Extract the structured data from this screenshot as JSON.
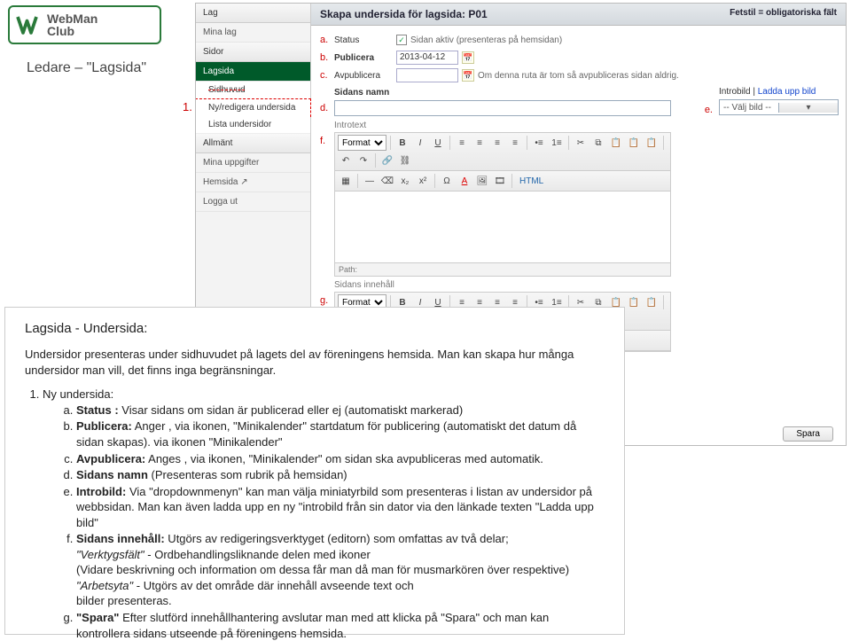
{
  "logo": {
    "l1": "WebMan",
    "l2": "Club"
  },
  "slide_title": "Ledare – \"Lagsida\"",
  "marker1": "1.",
  "side": {
    "grp_lag": "Lag",
    "mina_lag": "Mina lag",
    "grp_sidor": "Sidor",
    "lagsida": "Lagsida",
    "sidhuvud": "Sidhuvud",
    "ny_undersida": "Ny/redigera undersida",
    "lista_undersidor": "Lista undersidor",
    "grp_allmant": "Allmänt",
    "mina_uppgifter": "Mina uppgifter",
    "hemsida": "Hemsida ↗",
    "logga_ut": "Logga ut"
  },
  "header": {
    "title": "Skapa undersida för lagsida: P01",
    "required": "Fetstil = obligatoriska fält"
  },
  "rows": {
    "a": {
      "ann": "a.",
      "lab": "Status",
      "desc": "Sidan aktiv (presenteras på hemsidan)",
      "chk": "✓"
    },
    "b": {
      "ann": "b.",
      "lab": "Publicera",
      "date": "2013-04-12"
    },
    "c": {
      "ann": "c.",
      "lab": "Avpublicera",
      "desc": "Om denna ruta är tom så avpubliceras sidan aldrig."
    },
    "d": {
      "ann": "d.",
      "lab": "Sidans namn"
    },
    "f": {
      "ann": "f."
    },
    "g": {
      "ann": "g."
    },
    "e": {
      "ann": "e."
    }
  },
  "sec": {
    "introtext": "Introtext",
    "sidans_innehall": "Sidans innehåll",
    "path": "Path:",
    "format": "Format"
  },
  "intro": {
    "toplnk_pre": "Introbild | ",
    "toplnk_link": "Ladda upp bild",
    "sel": "-- Välj bild --",
    "dd": "▾"
  },
  "tb": {
    "html": "HTML"
  },
  "save": "Spara",
  "help": {
    "title": "Lagsida - Undersida:",
    "intro": "Undersidor presenteras under sidhuvudet på lagets del av föreningens hemsida. Man kan skapa hur många undersidor man vill, det finns inga begränsningar.",
    "li1": "Ny undersida:",
    "a": "Status : Visar sidans om sidan är publicerad eller ej (automatiskt markerad)",
    "b": "Publicera: Anger , via ikonen, \"Minikalender\" startdatum för publicering (automatiskt det datum då sidan skapas). via ikonen \"Minikalender\"",
    "c": "Avpublicera: Anges , via ikonen, \"Minikalender\" om sidan ska avpubliceras med automatik.",
    "d": "Sidans namn (Presenteras som rubrik på hemsidan)",
    "e": "Introbild: Via \"dropdownmenyn\" kan man välja miniatyrbild som presenteras i listan av undersidor på webbsidan. Man kan även ladda upp en ny \"introbild från sin dator via den länkade texten \"Ladda upp bild\"",
    "f1": "Sidans innehåll: Utgörs av redigeringsverktyget (editorn) som omfattas av två delar;",
    "f2": "\"Verktygsfält\" - Ordbehandlingsliknande delen med ikoner",
    "f3": "(Vidare beskrivning och information om dessa får man då man för musmarkören över respektive)",
    "f4": "\"Arbetsyta\"  - Utgörs av det område där innehåll avseende text och",
    "f5": "bilder presenteras.",
    "g": "\"Spara\" Efter slutförd  innehållhantering avslutar man med att klicka på \"Spara\" och man kan kontrollera sidans utseende på föreningens hemsida."
  }
}
